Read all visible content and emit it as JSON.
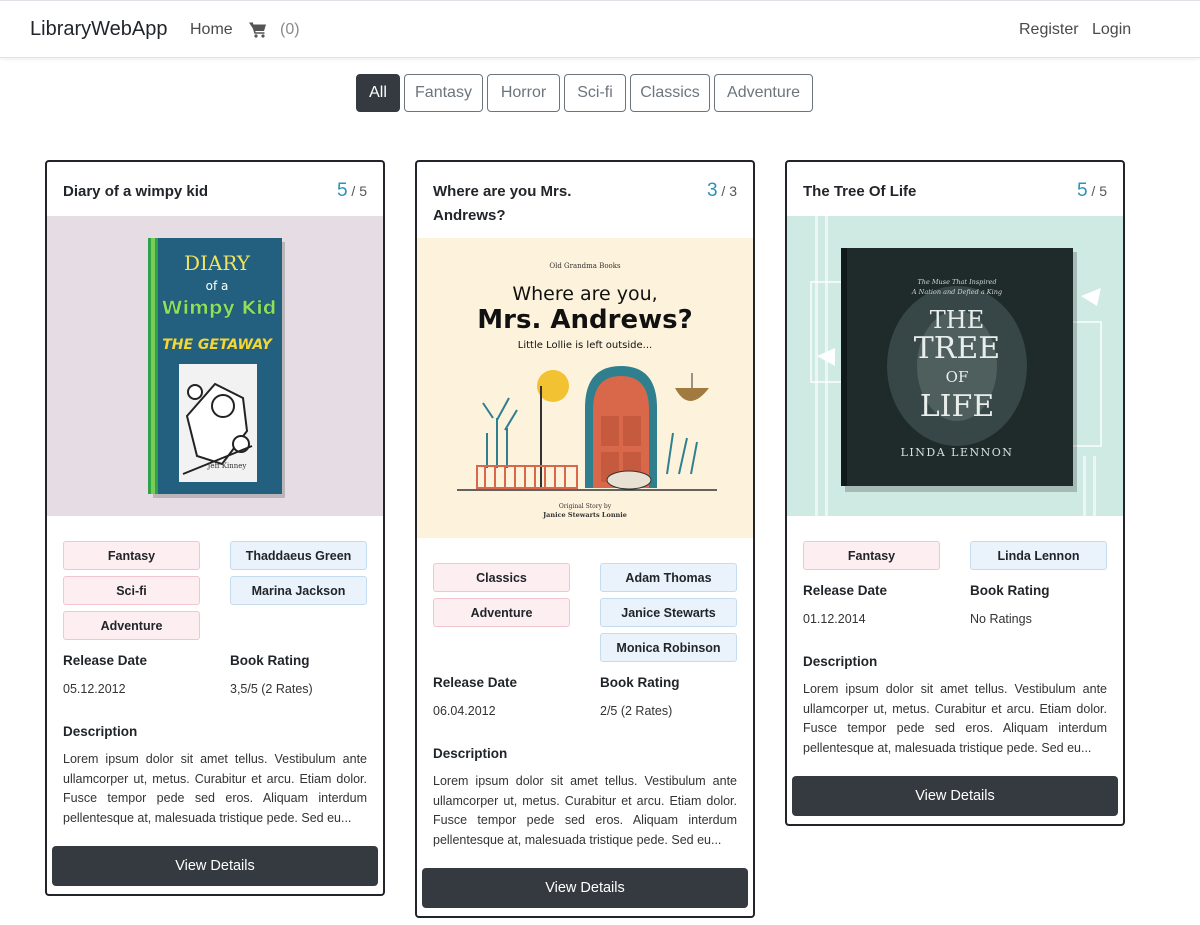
{
  "navbar": {
    "brand": "LibraryWebApp",
    "home": "Home",
    "cart_icon": "shopping-cart-icon",
    "cart_count": "(0)",
    "register": "Register",
    "login": "Login"
  },
  "filters": [
    "All",
    "Fantasy",
    "Horror",
    "Sci-fi",
    "Classics",
    "Adventure"
  ],
  "active_filter": "All",
  "labels": {
    "release_date": "Release Date",
    "book_rating": "Book Rating",
    "description": "Description",
    "view_details": "View Details"
  },
  "books": [
    {
      "title": "Diary of a wimpy kid",
      "available": "5",
      "total": "/ 5",
      "cover_lines": [
        "DIARY",
        "of a",
        "Wimpy Kid",
        "THE GETAWAY",
        "Jeff Kinney"
      ],
      "genres": [
        "Fantasy",
        "Sci-fi",
        "Adventure"
      ],
      "authors": [
        "Thaddaeus Green",
        "Marina Jackson"
      ],
      "release_date": "05.12.2012",
      "rating": "3,5/5 (2 Rates)",
      "description": "Lorem ipsum dolor sit amet tellus. Vestibulum ante ullamcorper ut, metus. Curabitur et arcu. Etiam dolor. Fusce tempor pede sed eros. Aliquam interdum pellentesque at, malesuada tristique pede. Sed eu..."
    },
    {
      "title": "Where are you Mrs. Andrews?",
      "available": "3",
      "total": "/ 3",
      "cover_lines": [
        "Old Grandma Books",
        "Where are you,",
        "Mrs. Andrews?",
        "Little Lollie is left outside...",
        "Original Story by",
        "Janice Stewarts Lonnie"
      ],
      "genres": [
        "Classics",
        "Adventure"
      ],
      "authors": [
        "Adam Thomas",
        "Janice Stewarts",
        "Monica Robinson"
      ],
      "release_date": "06.04.2012",
      "rating": "2/5 (2 Rates)",
      "description": "Lorem ipsum dolor sit amet tellus. Vestibulum ante ullamcorper ut, metus. Curabitur et arcu. Etiam dolor. Fusce tempor pede sed eros. Aliquam interdum pellentesque at, malesuada tristique pede. Sed eu..."
    },
    {
      "title": "The Tree Of Life",
      "available": "5",
      "total": "/ 5",
      "cover_lines": [
        "The Muse That Inspired",
        "A Nation and Defied a King",
        "THE",
        "TREE",
        "OF",
        "LIFE",
        "LINDA LENNON"
      ],
      "genres": [
        "Fantasy"
      ],
      "authors": [
        "Linda Lennon"
      ],
      "release_date": "01.12.2014",
      "rating": "No Ratings",
      "description": "Lorem ipsum dolor sit amet tellus. Vestibulum ante ullamcorper ut, metus. Curabitur et arcu. Etiam dolor. Fusce tempor pede sed eros. Aliquam interdum pellentesque at, malesuada tristique pede. Sed eu..."
    }
  ]
}
